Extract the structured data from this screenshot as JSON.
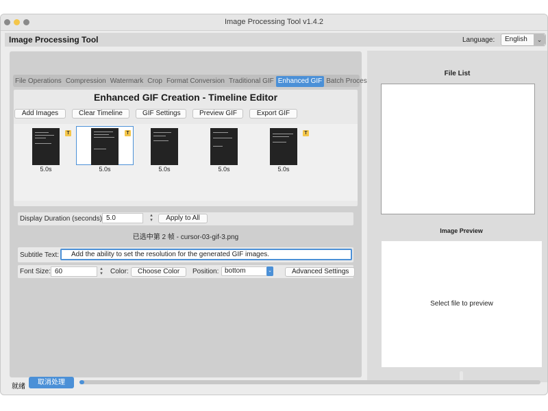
{
  "window": {
    "title": "Image Processing Tool v1.4.2"
  },
  "app": {
    "title": "Image Processing Tool"
  },
  "language": {
    "label": "Language:",
    "selected": "English"
  },
  "tabs": [
    {
      "label": "File Operations",
      "active": false
    },
    {
      "label": "Compression",
      "active": false
    },
    {
      "label": "Watermark",
      "active": false
    },
    {
      "label": "Crop",
      "active": false
    },
    {
      "label": "Format Conversion",
      "active": false
    },
    {
      "label": "Traditional GIF",
      "active": false
    },
    {
      "label": "Enhanced GIF",
      "active": true
    },
    {
      "label": "Batch Process",
      "active": false
    }
  ],
  "editor": {
    "title": "Enhanced GIF Creation - Timeline Editor",
    "buttons": {
      "add": "Add Images",
      "clear": "Clear Timeline",
      "settings": "GIF Settings",
      "preview": "Preview GIF",
      "export": "Export GIF"
    },
    "frames": [
      {
        "duration": "5.0s",
        "badge": "T",
        "selected": false
      },
      {
        "duration": "5.0s",
        "badge": "T",
        "selected": true
      },
      {
        "duration": "5.0s",
        "badge": "",
        "selected": false
      },
      {
        "duration": "5.0s",
        "badge": "",
        "selected": false
      },
      {
        "duration": "5.0s",
        "badge": "T",
        "selected": false
      }
    ]
  },
  "duration": {
    "label": "Display Duration (seconds):",
    "value": "5.0",
    "apply_button": "Apply to All"
  },
  "selection_status": "已选中第 2 帧 - cursor-03-gif-3.png",
  "subtitle": {
    "label": "Subtitle Text:",
    "value": "Add the ability to set the resolution for the generated GIF images."
  },
  "font": {
    "size_label": "Font Size:",
    "size_value": "60",
    "color_label": "Color:",
    "color_button": "Choose Color",
    "position_label": "Position:",
    "position_value": "bottom",
    "advanced_button": "Advanced Settings"
  },
  "file_list": {
    "title": "File List"
  },
  "preview": {
    "title": "Image Preview",
    "placeholder": "Select file to preview"
  },
  "status": {
    "text": "就绪",
    "cancel_button": "取消处理",
    "progress": 0.01
  },
  "colors": {
    "accent": "#4b90d7",
    "badge": "#f4c64a"
  }
}
